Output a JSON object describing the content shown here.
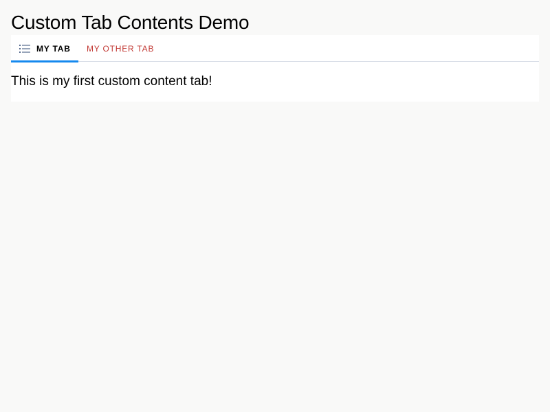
{
  "page": {
    "title": "Custom Tab Contents Demo"
  },
  "tabs": [
    {
      "label": "MY TAB",
      "icon": "list-icon",
      "active": true
    },
    {
      "label": "MY OTHER TAB",
      "active": false
    }
  ],
  "tab_content": {
    "text": "This is my first custom content tab!"
  },
  "colors": {
    "background": "#f9f9f8",
    "active_indicator": "#1589ee",
    "inactive_tab_text": "#c23934"
  }
}
